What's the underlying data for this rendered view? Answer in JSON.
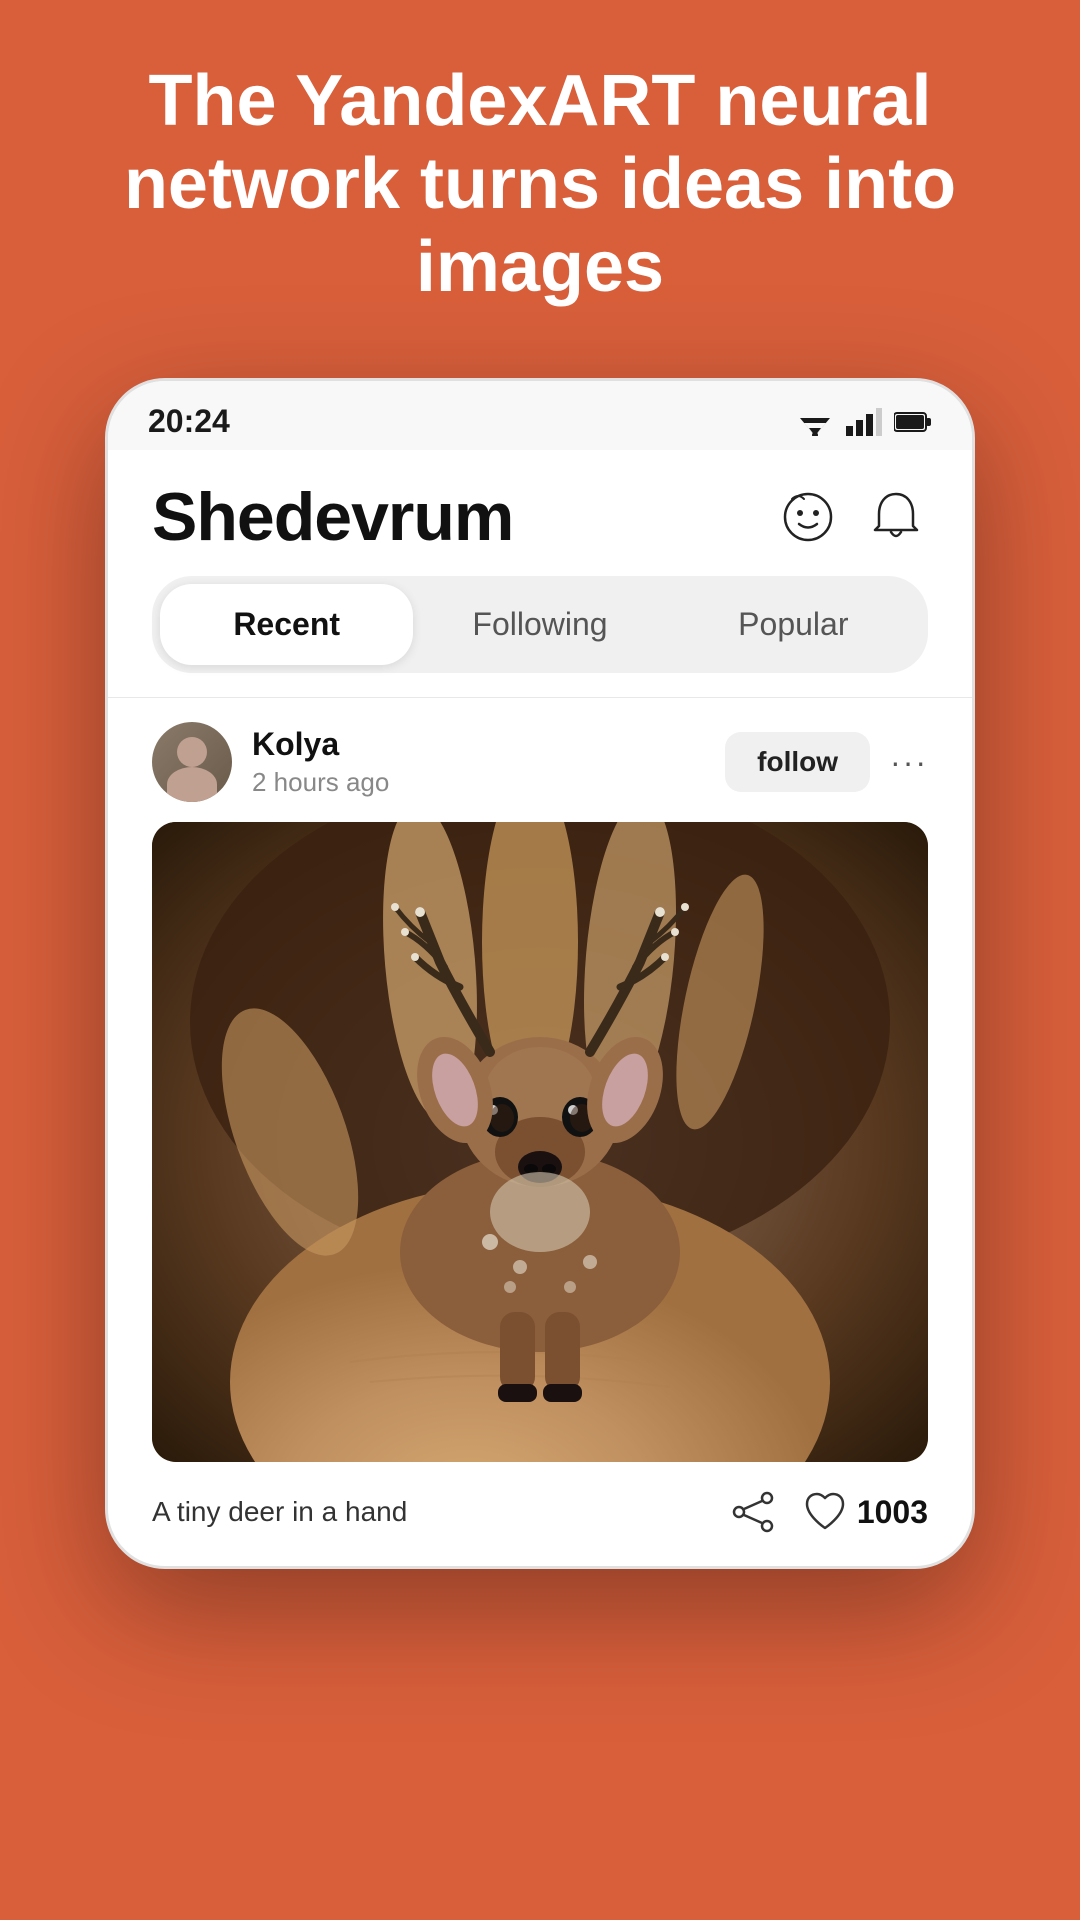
{
  "hero": {
    "title": "The YandexART neural network turns ideas into images"
  },
  "status_bar": {
    "time": "20:24"
  },
  "header": {
    "title": "Shedevrum",
    "face_icon": "face-icon",
    "bell_icon": "bell-icon"
  },
  "tabs": [
    {
      "label": "Recent",
      "active": true
    },
    {
      "label": "Following",
      "active": false
    },
    {
      "label": "Popular",
      "active": false
    }
  ],
  "post": {
    "username": "Kolya",
    "time": "2 hours ago",
    "follow_label": "follow",
    "caption": "A tiny deer in a hand",
    "like_count": "1003"
  }
}
